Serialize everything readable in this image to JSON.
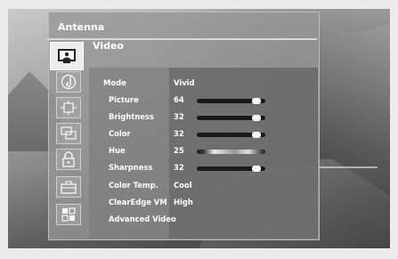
{
  "source": "Antenna",
  "page_title": "Video",
  "sidebar": {
    "items": [
      {
        "name": "video",
        "icon": "picture-icon",
        "active": true
      },
      {
        "name": "audio",
        "icon": "music-note-icon"
      },
      {
        "name": "display",
        "icon": "screen-adjust-icon"
      },
      {
        "name": "pip",
        "icon": "pip-icon"
      },
      {
        "name": "lock",
        "icon": "lock-icon"
      },
      {
        "name": "setup",
        "icon": "toolbox-icon"
      },
      {
        "name": "features",
        "icon": "grid-icon"
      }
    ]
  },
  "settings": {
    "mode": {
      "label": "Mode",
      "value": "Vivid"
    },
    "picture": {
      "label": "Picture",
      "value": "64",
      "level": 0.64
    },
    "brightness": {
      "label": "Brightness",
      "value": "32",
      "level": 0.64
    },
    "color": {
      "label": "Color",
      "value": "32",
      "level": 0.64
    },
    "hue": {
      "label": "Hue",
      "value": "25",
      "level": 0.25
    },
    "sharpness": {
      "label": "Sharpness",
      "value": "32",
      "level": 0.64
    },
    "color_temp": {
      "label": "Color Temp.",
      "value": "Cool"
    },
    "clearedge": {
      "label": "ClearEdge VM",
      "value": "High"
    },
    "advanced": {
      "label": "Advanced Video"
    }
  }
}
